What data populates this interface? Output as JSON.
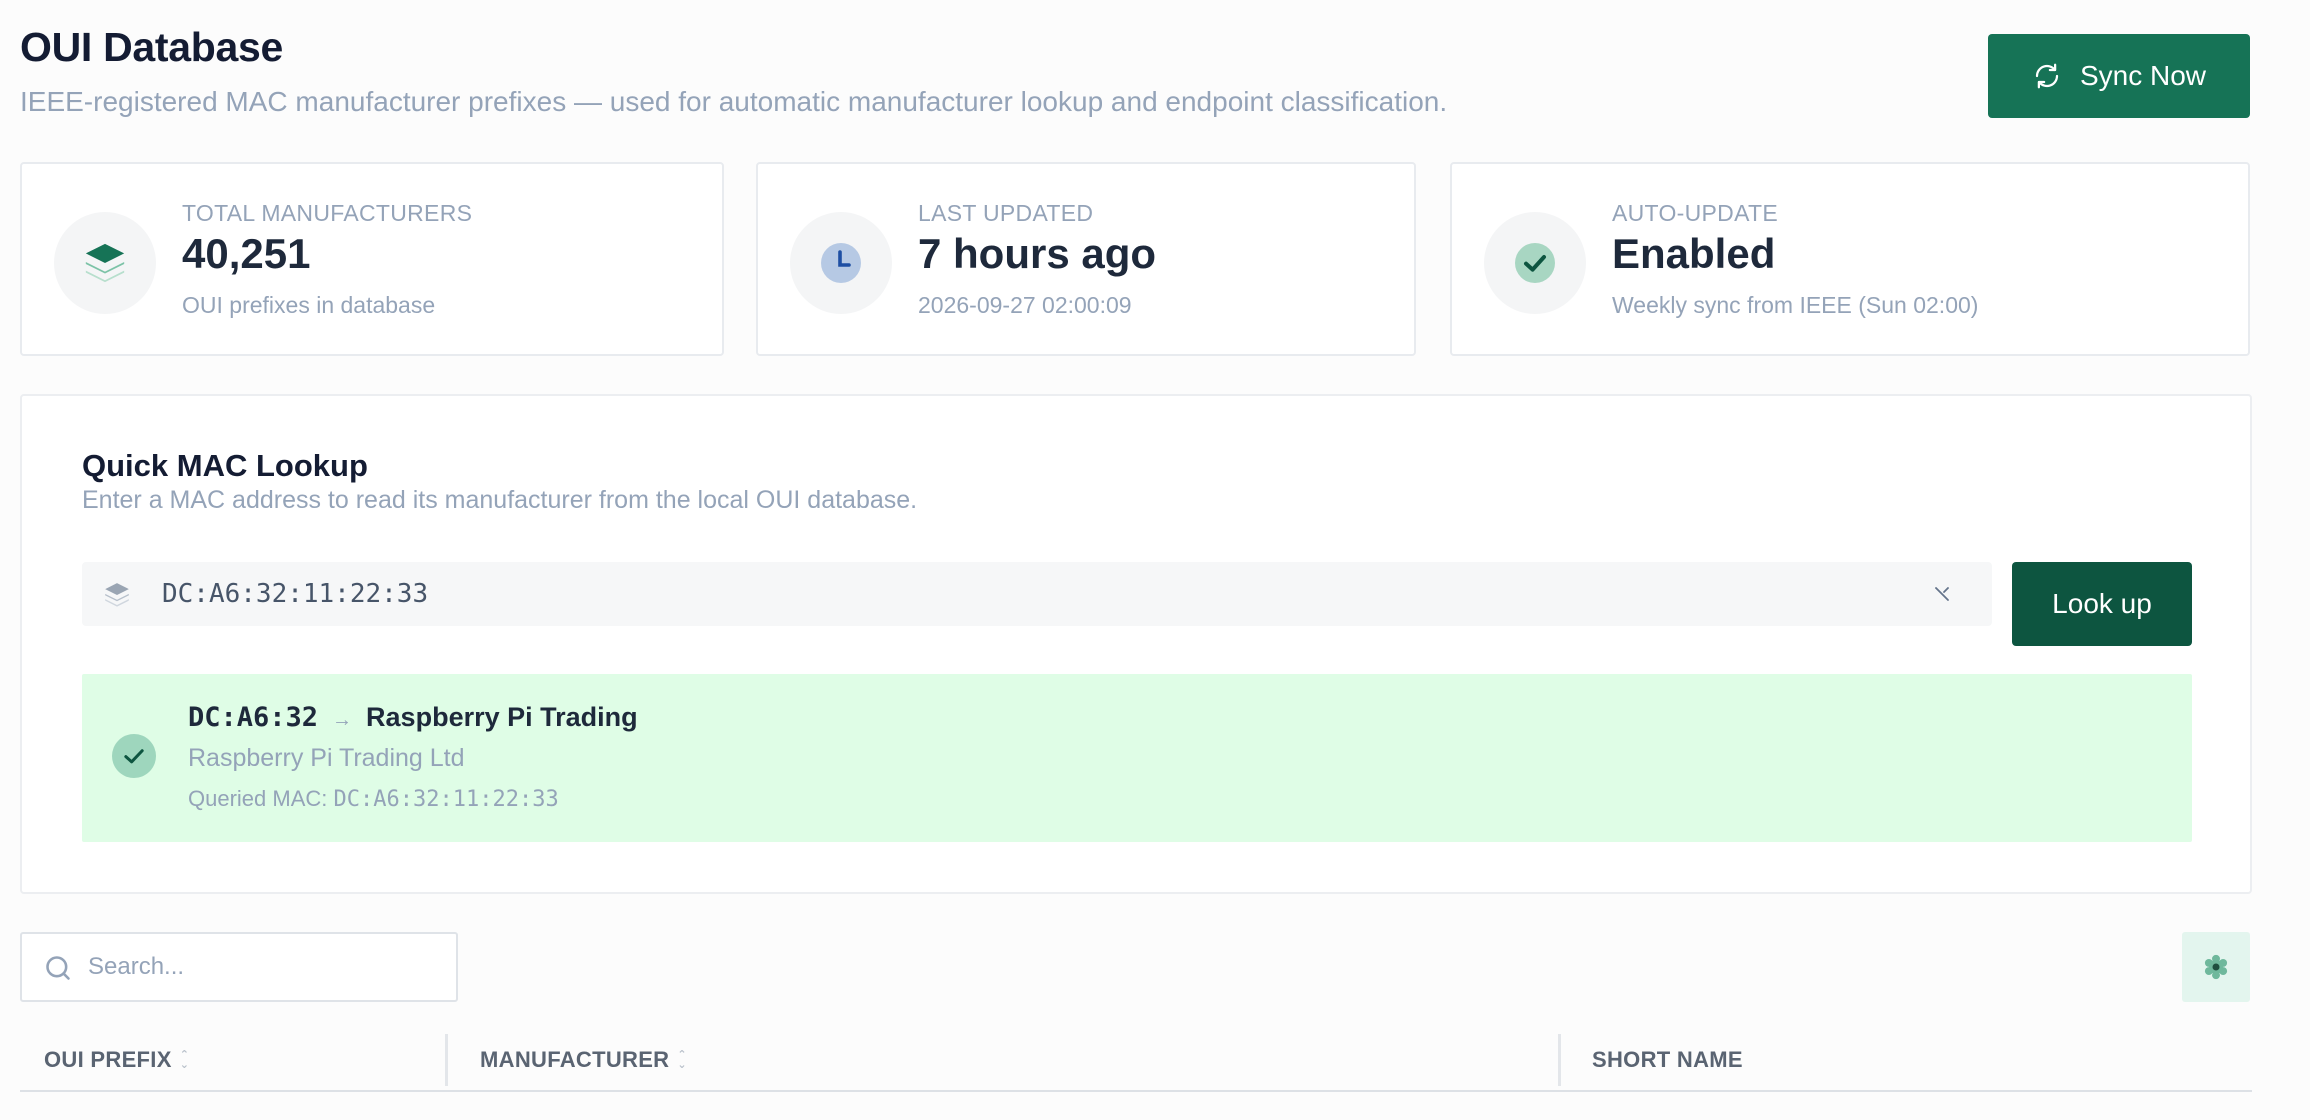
{
  "header": {
    "title": "OUI Database",
    "subtitle": "IEEE-registered MAC manufacturer prefixes — used for automatic manufacturer lookup and endpoint classification.",
    "sync_label": "Sync Now"
  },
  "stats": [
    {
      "label": "TOTAL MANUFACTURERS",
      "value": "40,251",
      "sub": "OUI prefixes in database",
      "icon": "layers-icon"
    },
    {
      "label": "LAST UPDATED",
      "value": "7 hours ago",
      "sub": "2026-09-27 02:00:09",
      "icon": "clock-icon"
    },
    {
      "label": "AUTO-UPDATE",
      "value": "Enabled",
      "sub": "Weekly sync from IEEE (Sun 02:00)",
      "icon": "check-circle-icon"
    }
  ],
  "lookup": {
    "title": "Quick MAC Lookup",
    "subtitle": "Enter a MAC address to read its manufacturer from the local OUI database.",
    "input_value": "DC:A6:32:11:22:33",
    "button_label": "Look up",
    "result": {
      "prefix": "DC:A6:32",
      "arrow": "→",
      "short_name": "Raspberry Pi Trading",
      "full_name": "Raspberry Pi Trading Ltd",
      "queried_label": "Queried MAC:",
      "queried_mac": "DC:A6:32:11:22:33"
    }
  },
  "table": {
    "search_placeholder": "Search...",
    "columns": [
      "OUI PREFIX",
      "MANUFACTURER",
      "SHORT NAME"
    ]
  },
  "colors": {
    "accent": "#167356",
    "accent_dark": "#0d5540",
    "success_bg": "#dffde6"
  }
}
